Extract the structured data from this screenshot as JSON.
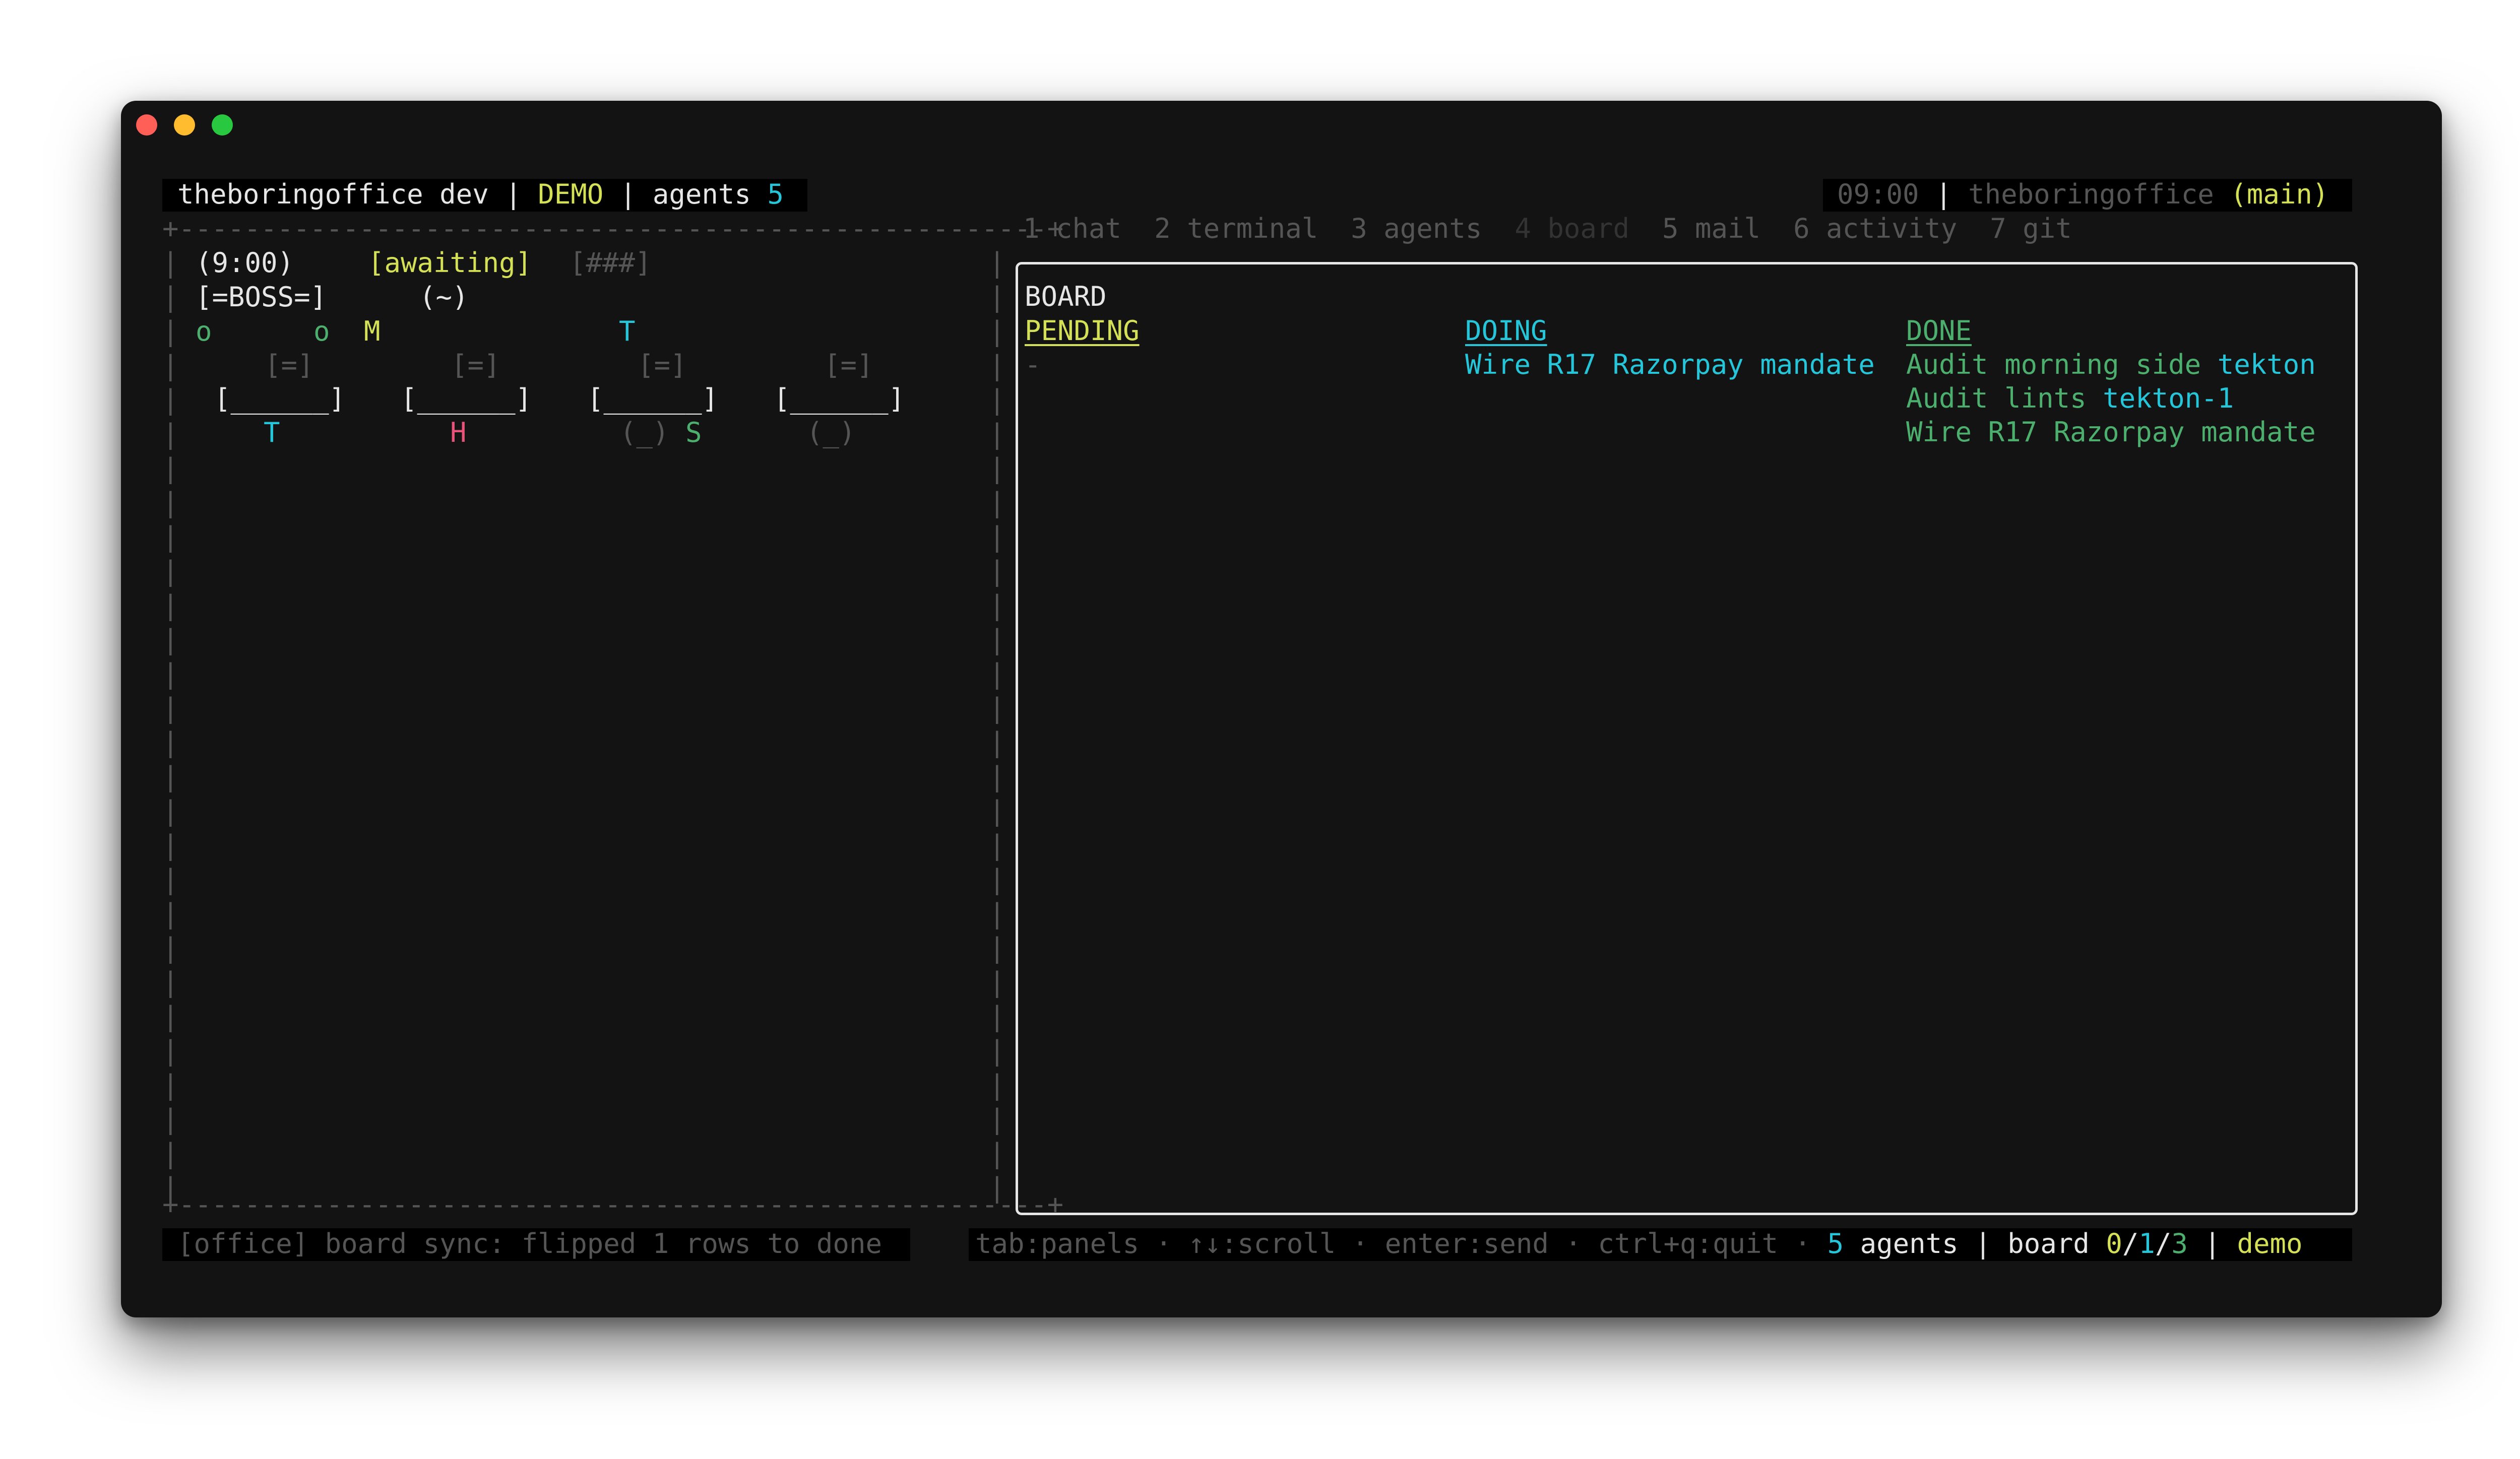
{
  "window": {
    "traffic_lights": {
      "close": "#ff5f57",
      "minimize": "#febc2e",
      "maximize": "#28c840"
    }
  },
  "header_left": {
    "app": "theboringoffice dev",
    "sep1": "|",
    "mode": "DEMO",
    "sep2": "|",
    "agents_label": "agents",
    "agents_count": "5"
  },
  "header_right": {
    "time": "09:00",
    "sep": "|",
    "repo": "theboringoffice",
    "branch": "(main)"
  },
  "tabs": [
    {
      "label": "1 chat",
      "active": false
    },
    {
      "label": "2 terminal",
      "active": false
    },
    {
      "label": "3 agents",
      "active": false
    },
    {
      "label": "4 board",
      "active": true
    },
    {
      "label": "5 mail",
      "active": false
    },
    {
      "label": "6 activity",
      "active": false
    },
    {
      "label": "7 git",
      "active": false
    }
  ],
  "office_scene": {
    "clock": "(9:00)",
    "status": "[awaiting]",
    "progress": "[###]",
    "boss": "[=BOSS=]",
    "boss_face": "(~)",
    "floor_row": [
      "o",
      "o",
      "M",
      "T"
    ],
    "monitors": [
      "[=]",
      "[=]",
      "[=]",
      "[=]"
    ],
    "desks": [
      "[______]",
      "[______]",
      "[______]",
      "[______]"
    ],
    "workers": [
      "T",
      "H",
      "(_)",
      "S",
      "(_)"
    ]
  },
  "board": {
    "title": "BOARD",
    "columns": {
      "pending": {
        "header": "PENDING",
        "items": [
          "-"
        ]
      },
      "doing": {
        "header": "DOING",
        "items": [
          "Wire R17 Razorpay mandate"
        ]
      },
      "done": {
        "header": "DONE",
        "items": [
          {
            "text": "Audit morning side",
            "tag": "tekton"
          },
          {
            "text": "Audit lints",
            "tag": "tekton-1"
          },
          {
            "text": "Wire R17 Razorpay mandate",
            "tag": ""
          }
        ]
      }
    }
  },
  "status_left": "[office] board sync: flipped 1 rows to done",
  "status_right": {
    "hints": "tab:panels · ↑↓:scroll · enter:send · ctrl+q:quit ·",
    "agents_count": "5",
    "agents_label": "agents",
    "sep1": "|",
    "board_label": "board",
    "pending": "0",
    "slash1": "/",
    "doing": "1",
    "slash2": "/",
    "done": "3",
    "sep2": "|",
    "mode": "demo"
  },
  "colors": {
    "yellow": "#d4e157",
    "cyan": "#26c6da",
    "green": "#4caf6e",
    "pink": "#e8537a",
    "white": "#e6e6e6",
    "grey": "#8a8a8a",
    "dim": "#555555"
  }
}
